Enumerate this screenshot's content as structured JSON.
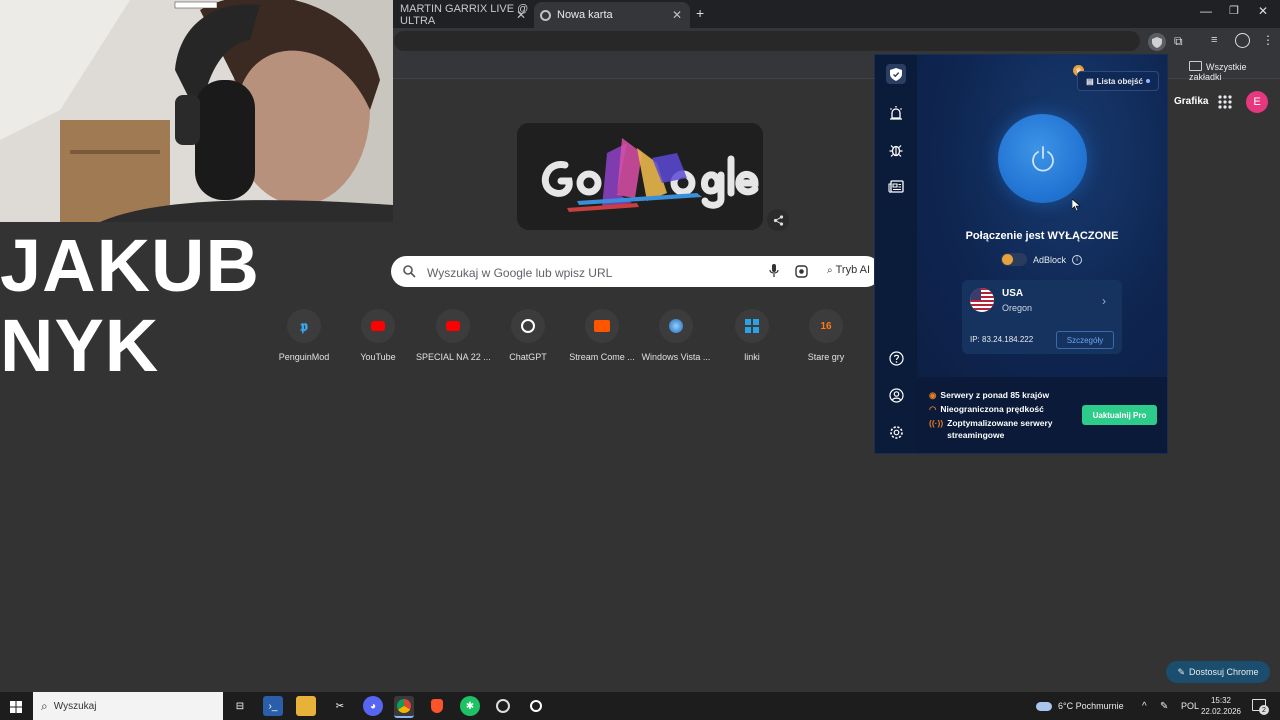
{
  "browser": {
    "tabs": [
      {
        "label": "MARTIN GARRIX LIVE @ ULTRA"
      },
      {
        "label": "Nowa karta"
      }
    ],
    "all_bookmarks": "Wszystkie zakładki"
  },
  "overlay": {
    "streamer_name": "JAKUB NYK"
  },
  "newtab": {
    "search_placeholder": "Wyszukaj w Google lub wpisz URL",
    "ai_mode": "Tryb AI",
    "header_link": "Grafika",
    "avatar_letter": "E",
    "customize": "Dostosuj Chrome",
    "shortcuts": [
      {
        "label": "PenguinMod",
        "icon": "penguinmod-icon"
      },
      {
        "label": "YouTube",
        "icon": "youtube-icon"
      },
      {
        "label": "SPECIAL NA 22 ...",
        "icon": "youtube-icon"
      },
      {
        "label": "ChatGPT",
        "icon": "chatgpt-icon"
      },
      {
        "label": "Stream Come ...",
        "icon": "soundcloud-icon"
      },
      {
        "label": "Windows Vista ...",
        "icon": "windows-vista-icon"
      },
      {
        "label": "linki",
        "icon": "windows-grid-icon"
      },
      {
        "label": "Stare gry",
        "icon": "stare-gry-icon"
      }
    ]
  },
  "vpn": {
    "bypass_list": "Lista obejść",
    "connection_status": "Połączenie jest WYŁĄCZONE",
    "adblock_label": "AdBlock",
    "location": {
      "country": "USA",
      "region": "Oregon",
      "ip": "IP: 83.24.184.222",
      "details_button": "Szczegóły"
    },
    "promo": {
      "line1": "Serwery z ponad 85 krajów",
      "line2": "Nieograniczona prędkość",
      "line3": "Zoptymalizowane serwery streamingowe",
      "upgrade_button": "Uaktualnij Pro"
    },
    "accent": "#2274d3",
    "upgrade_color": "#2ecc8a"
  },
  "taskbar": {
    "search_label": "Wyszukaj",
    "weather": "6°C  Pochmurnie",
    "language": "POL",
    "time": "15:32",
    "date": "22.02.2026",
    "notifications": "2"
  }
}
